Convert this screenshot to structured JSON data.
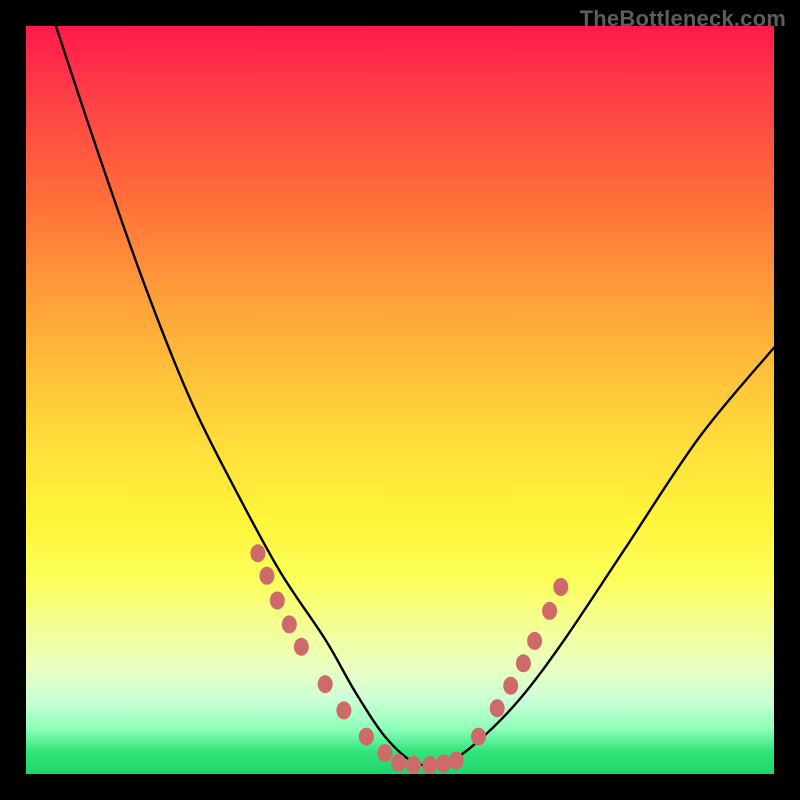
{
  "watermark": "TheBottleneck.com",
  "chart_data": {
    "type": "line",
    "title": "",
    "xlabel": "",
    "ylabel": "",
    "xlim": [
      0,
      1
    ],
    "ylim": [
      0,
      1
    ],
    "series": [
      {
        "name": "curve",
        "color": "#000000",
        "x": [
          0.04,
          0.1,
          0.16,
          0.22,
          0.28,
          0.34,
          0.4,
          0.44,
          0.48,
          0.52,
          0.56,
          0.6,
          0.66,
          0.72,
          0.8,
          0.9,
          1.0
        ],
        "y": [
          1.0,
          0.82,
          0.65,
          0.5,
          0.38,
          0.27,
          0.18,
          0.11,
          0.05,
          0.015,
          0.015,
          0.04,
          0.1,
          0.18,
          0.3,
          0.45,
          0.57
        ]
      }
    ],
    "markers": [
      {
        "name": "dots",
        "color": "#cf6a6a",
        "points": [
          {
            "x": 0.31,
            "y": 0.295
          },
          {
            "x": 0.322,
            "y": 0.265
          },
          {
            "x": 0.336,
            "y": 0.232
          },
          {
            "x": 0.352,
            "y": 0.2
          },
          {
            "x": 0.368,
            "y": 0.17
          },
          {
            "x": 0.4,
            "y": 0.12
          },
          {
            "x": 0.425,
            "y": 0.085
          },
          {
            "x": 0.455,
            "y": 0.05
          },
          {
            "x": 0.48,
            "y": 0.028
          },
          {
            "x": 0.498,
            "y": 0.015
          },
          {
            "x": 0.518,
            "y": 0.012
          },
          {
            "x": 0.54,
            "y": 0.012
          },
          {
            "x": 0.558,
            "y": 0.014
          },
          {
            "x": 0.575,
            "y": 0.018
          },
          {
            "x": 0.605,
            "y": 0.05
          },
          {
            "x": 0.63,
            "y": 0.088
          },
          {
            "x": 0.648,
            "y": 0.118
          },
          {
            "x": 0.665,
            "y": 0.148
          },
          {
            "x": 0.68,
            "y": 0.178
          },
          {
            "x": 0.7,
            "y": 0.218
          },
          {
            "x": 0.715,
            "y": 0.25
          }
        ]
      }
    ]
  }
}
